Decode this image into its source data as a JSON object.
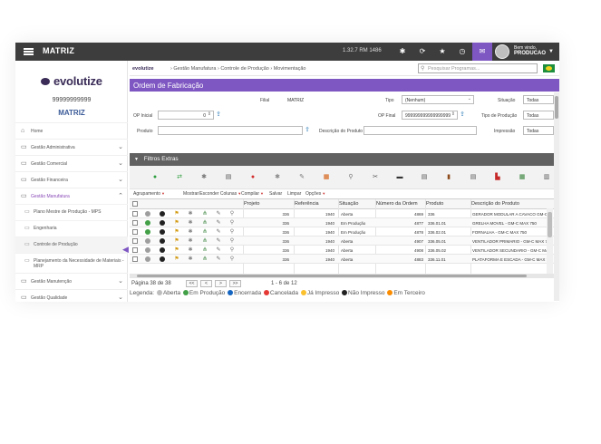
{
  "topbar": {
    "brand": "MATRIZ",
    "version": "1.32.7 RM 1486",
    "icons": [
      "settings-icon",
      "refresh-icon",
      "star-icon",
      "history-icon",
      "mail-icon"
    ],
    "welcome": "Bem vindo,",
    "user": "PRODUCAO"
  },
  "sidebar": {
    "logo": "evolutize",
    "company_code": "99999999999",
    "company_name": "MATRIZ",
    "items": [
      {
        "label": "Home"
      },
      {
        "label": "Gestão Administrativa"
      },
      {
        "label": "Gestão Comercial"
      },
      {
        "label": "Gestão Financeira"
      },
      {
        "label": "Gestão Manufatura"
      },
      {
        "label": "Gestão Manutenção"
      },
      {
        "label": "Gestão Qualidade"
      }
    ],
    "submenu": [
      {
        "label": "Plano Mestre de Produção - MPS"
      },
      {
        "label": "Engenharia"
      },
      {
        "label": "Controle de Produção"
      },
      {
        "label": "Planejamento da Necessidade de Materiais - MRP"
      }
    ]
  },
  "breadcrumb": {
    "logo": "evolutize",
    "path": "›  Gestão Manufatura  ›  Controle de Produção  ›  Movimentação",
    "search_placeholder": "Pesquisar Programas..."
  },
  "page_title": "Ordem de Fabricação",
  "form": {
    "filial_label": "Filial",
    "filial_value": "MATRIZ",
    "tipo_label": "Tipo",
    "tipo_value": "(Nenhum)",
    "situacao_label": "Situação",
    "situacao_value": "Todas",
    "op_inicial_label": "OP Inicial",
    "op_inicial_value": "0",
    "op_final_label": "OP Final",
    "op_final_value": "999999999999999999",
    "tipo_producao_label": "Tipo de Produção",
    "tipo_producao_value": "Todas",
    "produto_label": "Produto",
    "produto_value": "",
    "descricao_label": "Descrição do Produto",
    "impressao_label": "Impressão",
    "impressao_value": "Todas"
  },
  "filters_title": "Filtros Extras",
  "toolbar_icons": [
    {
      "name": "add-icon",
      "glyph": "●",
      "color": "#2e9e3f"
    },
    {
      "name": "transfer-icon",
      "glyph": "⇄",
      "color": "#2e9e3f"
    },
    {
      "name": "gear-icon",
      "glyph": "✱",
      "color": "#777"
    },
    {
      "name": "copy-icon",
      "glyph": "▤",
      "color": "#555"
    },
    {
      "name": "cancel-icon",
      "glyph": "●",
      "color": "#d32f2f"
    },
    {
      "name": "settings2-icon",
      "glyph": "✱",
      "color": "#888"
    },
    {
      "name": "edit-icon",
      "glyph": "✎",
      "color": "#777"
    },
    {
      "name": "calendar-icon",
      "glyph": "▦",
      "color": "#d35400"
    },
    {
      "name": "zoom-icon",
      "glyph": "⚲",
      "color": "#777"
    },
    {
      "name": "chart-icon",
      "glyph": "✂",
      "color": "#555"
    },
    {
      "name": "print-icon",
      "glyph": "▬",
      "color": "#333"
    },
    {
      "name": "clipboard-icon",
      "glyph": "▤",
      "color": "#555"
    },
    {
      "name": "book-icon",
      "glyph": "▮",
      "color": "#8d4a1a"
    },
    {
      "name": "report-icon",
      "glyph": "▤",
      "color": "#555"
    },
    {
      "name": "pdf-icon",
      "glyph": "▙",
      "color": "#c62828"
    },
    {
      "name": "excel-icon",
      "glyph": "▦",
      "color": "#2e7d32"
    },
    {
      "name": "export-icon",
      "glyph": "▥",
      "color": "#555"
    }
  ],
  "actions": [
    {
      "label": "Agrupamento"
    },
    {
      "label": "Mostrar/Esconder Colunas"
    },
    {
      "label": "Compilar"
    },
    {
      "label": "Salvar"
    },
    {
      "label": "Limpar"
    },
    {
      "label": "Opções"
    }
  ],
  "table": {
    "columns": [
      "Projeto",
      "Referência",
      "Situação",
      "Número da Ordem",
      "Produto",
      "Descrição do Produto"
    ],
    "rows": [
      {
        "status_color": "#9e9e9e",
        "projeto": "336",
        "referencia": "1940",
        "situacao": "Aberta",
        "numero": "4869",
        "produto": "336",
        "descricao": "GERADOR MODULAR A CAVACO GM-C"
      },
      {
        "status_color": "#43a047",
        "projeto": "336",
        "referencia": "1940",
        "situacao": "Em Produção",
        "numero": "4877",
        "produto": "336.01.01",
        "descricao": "GRELHA MOVEL - GM-C MAX 750"
      },
      {
        "status_color": "#43a047",
        "projeto": "336",
        "referencia": "1940",
        "situacao": "Em Produção",
        "numero": "4878",
        "produto": "336.02.01",
        "descricao": "FORNALHA - GM-C MAX 750"
      },
      {
        "status_color": "#9e9e9e",
        "projeto": "336",
        "referencia": "1940",
        "situacao": "Aberta",
        "numero": "4907",
        "produto": "336.05.01",
        "descricao": "VENTILADOR PRIMARIO - GM-C MAX 7"
      },
      {
        "status_color": "#9e9e9e",
        "projeto": "336",
        "referencia": "1940",
        "situacao": "Aberta",
        "numero": "4908",
        "produto": "336.05.02",
        "descricao": "VENTILADOR SECUNDARIO - GM-C MA"
      },
      {
        "status_color": "#9e9e9e",
        "projeto": "336",
        "referencia": "1940",
        "situacao": "Aberta",
        "numero": "4883",
        "produto": "336.11.01",
        "descricao": "PLATAFORMA E ESCADA - GM-C MAX 7"
      }
    ]
  },
  "pager": {
    "page_label": "Página 38 de 38",
    "first": "<<",
    "prev": "<",
    "next": ">",
    "last": ">>",
    "range": "1 - 6 de 12"
  },
  "legend": {
    "title": "Legenda:",
    "items": [
      {
        "label": "Aberta",
        "color": "#bdbdbd"
      },
      {
        "label": "Em Produção",
        "color": "#43a047"
      },
      {
        "label": "Encerrada",
        "color": "#1565c0"
      },
      {
        "label": "Cancelada",
        "color": "#e53935"
      },
      {
        "label": "Já Impresso",
        "color": "#fbc02d"
      },
      {
        "label": "Não Impresso",
        "color": "#212121"
      },
      {
        "label": "Em Terceiro",
        "color": "#fb8c00"
      }
    ]
  },
  "colors": {
    "accent": "#7e57c2",
    "topbar": "#3d3d3d",
    "filters_bar": "#616161"
  }
}
